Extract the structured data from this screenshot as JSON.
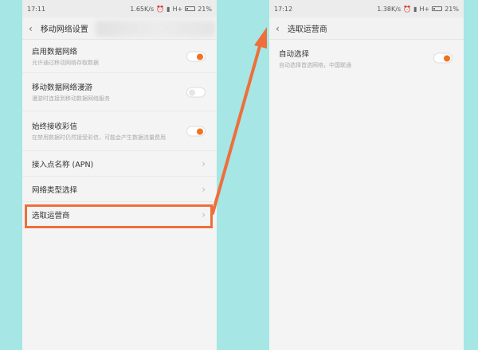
{
  "left_phone": {
    "status": {
      "time": "17:11",
      "speed": "1.65K/s",
      "network": "H+",
      "battery": "21%"
    },
    "header": {
      "title": "移动网络设置"
    },
    "items": [
      {
        "title": "启用数据网络",
        "subtitle": "允许通过移动网络存取数据",
        "control": "toggle-on"
      },
      {
        "title": "移动数据网络漫游",
        "subtitle": "漫游时连接到移动数据网络服务",
        "control": "toggle-off"
      },
      {
        "title": "始终接收彩信",
        "subtitle": "在禁用数据时仍然接受彩信，可能会产生数据流量费用",
        "control": "toggle-on"
      },
      {
        "title": "接入点名称 (APN)",
        "control": "chevron"
      },
      {
        "title": "网络类型选择",
        "control": "chevron"
      },
      {
        "title": "选取运营商",
        "control": "chevron"
      }
    ]
  },
  "right_phone": {
    "status": {
      "time": "17:12",
      "speed": "1.38K/s",
      "network": "H+",
      "battery": "21%"
    },
    "header": {
      "title": "选取运营商"
    },
    "items": [
      {
        "title": "自动选择",
        "subtitle": "自动选择首选网络，中国联通",
        "control": "toggle-on"
      }
    ]
  },
  "colors": {
    "accent": "#f0731f",
    "highlight": "#ee6f3b",
    "background": "#a6e6e4"
  },
  "icons": {
    "back": "chevron-left-icon",
    "chevron": "chevron-right-icon"
  }
}
